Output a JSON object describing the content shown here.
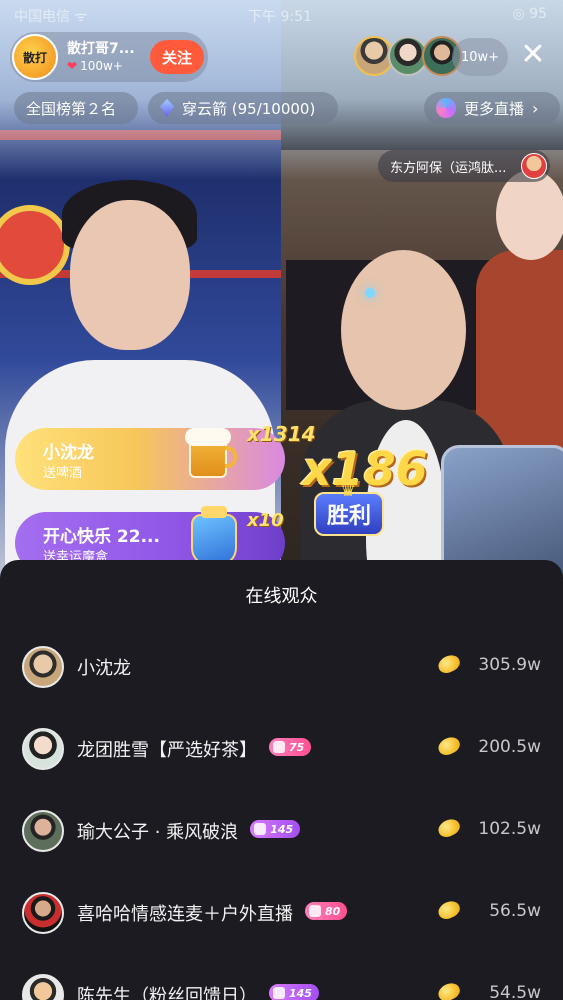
{
  "status_bar": {
    "carrier": "中国电信 ᯤ",
    "time": "下午 9:51",
    "battery": "◎ 95"
  },
  "host": {
    "name": "散打哥7...",
    "likes": "100w+",
    "avatar_text": "散打",
    "follow_label": "关注"
  },
  "viewers": {
    "count": "10w+",
    "close_glyph": "✕"
  },
  "chips": {
    "rank": "全国榜第２名",
    "arrow": "穿云箭 (95/10000)",
    "more": "更多直播",
    "more_chevron": "›"
  },
  "pk": {
    "opponent": "东方阿保（运鸿肽...",
    "multiplier": "x186",
    "win_label": "胜利",
    "win_crown": "♛"
  },
  "gifts": [
    {
      "name": "小沈龙",
      "desc": "送啤酒",
      "count": "x1314"
    },
    {
      "name": "开心快乐 22...",
      "desc": "送幸运魔盒",
      "count": "x10"
    }
  ],
  "sheet": {
    "title": "在线观众",
    "rows": [
      {
        "name": "小沈龙",
        "level": "",
        "amount": "305.9w"
      },
      {
        "name": "龙团胜雪【严选好茶】",
        "level": "75",
        "level_style": "pink",
        "amount": "200.5w"
      },
      {
        "name": "瑜大公子 · 乘风破浪",
        "level": "145",
        "level_style": "purple",
        "amount": "102.5w"
      },
      {
        "name": "喜哈哈情感连麦＋户外直播",
        "level": "80",
        "level_style": "pink",
        "amount": "56.5w"
      },
      {
        "name": "陈先生（粉丝回馈日）",
        "level": "145",
        "level_style": "purple",
        "amount": "54.5w"
      }
    ]
  },
  "colors": {
    "follow": "#ff5a3c",
    "sheet_bg": "#1c1b21",
    "coin": "#f3b81d"
  }
}
